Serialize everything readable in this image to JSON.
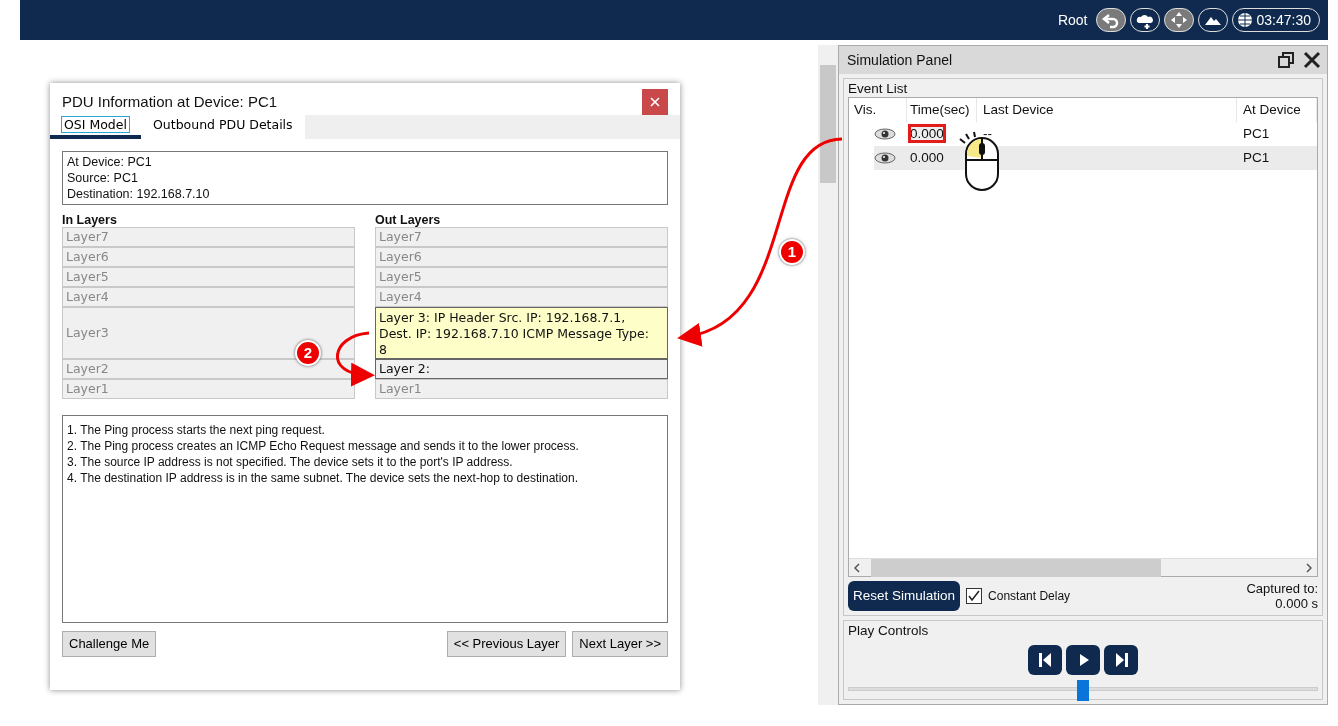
{
  "top_bar": {
    "user": "Root",
    "clock": "03:47:30"
  },
  "pdu_dialog": {
    "title": "PDU Information at Device: PC1",
    "tabs": [
      {
        "label": "OSI Model",
        "selected": true
      },
      {
        "label": "Outbound PDU Details",
        "selected": false
      }
    ],
    "info_lines": [
      "At Device: PC1",
      "Source: PC1",
      "Destination: 192.168.7.10"
    ],
    "in_layers": {
      "heading": "In Layers",
      "layers": [
        {
          "label": "Layer7",
          "enabled": false,
          "selected": false
        },
        {
          "label": "Layer6",
          "enabled": false,
          "selected": false
        },
        {
          "label": "Layer5",
          "enabled": false,
          "selected": false
        },
        {
          "label": "Layer4",
          "enabled": false,
          "selected": false
        },
        {
          "label": "Layer3",
          "enabled": false,
          "selected": false
        },
        {
          "label": "Layer2",
          "enabled": false,
          "selected": false
        },
        {
          "label": "Layer1",
          "enabled": false,
          "selected": false
        }
      ]
    },
    "out_layers": {
      "heading": "Out Layers",
      "layers": [
        {
          "label": "Layer7",
          "enabled": false,
          "selected": false
        },
        {
          "label": "Layer6",
          "enabled": false,
          "selected": false
        },
        {
          "label": "Layer5",
          "enabled": false,
          "selected": false
        },
        {
          "label": "Layer4",
          "enabled": false,
          "selected": false
        },
        {
          "label": "Layer 3: IP Header Src. IP: 192.168.7.1, Dest. IP: 192.168.7.10 ICMP Message Type: 8",
          "enabled": true,
          "selected": true
        },
        {
          "label": "Layer 2:",
          "enabled": true,
          "selected": false
        },
        {
          "label": "Layer1",
          "enabled": false,
          "selected": false
        }
      ]
    },
    "description": [
      "1. The Ping process starts the next ping request.",
      "2. The Ping process creates an ICMP Echo Request message and sends it to the lower process.",
      "3. The source IP address is not specified. The device sets it to the port's IP address.",
      "4. The destination IP address is in the same subnet. The device sets the next-hop to destination."
    ],
    "challenge_button": "Challenge Me",
    "previous_button": "<< Previous Layer",
    "next_button": "Next Layer >>"
  },
  "simulation_panel": {
    "title": "Simulation Panel",
    "event_list": {
      "label": "Event List",
      "columns": [
        "Vis.",
        "Time(sec)",
        "Last Device",
        "At Device"
      ],
      "rows": [
        {
          "time": "0.000",
          "last_device": "--",
          "at_device": "PC1",
          "selected": false,
          "highlighted": true
        },
        {
          "time": "0.000",
          "at_device": "PC1",
          "selected": true,
          "highlighted": false
        }
      ]
    },
    "reset_button": "Reset Simulation",
    "constant_delay": {
      "label": "Constant Delay",
      "checked": true
    },
    "captured_label": "Captured to:",
    "captured_value": "0.000 s",
    "play_controls": {
      "label": "Play Controls",
      "level": 0.5
    }
  },
  "annotations": [
    {
      "label": "1"
    },
    {
      "label": "2"
    }
  ]
}
